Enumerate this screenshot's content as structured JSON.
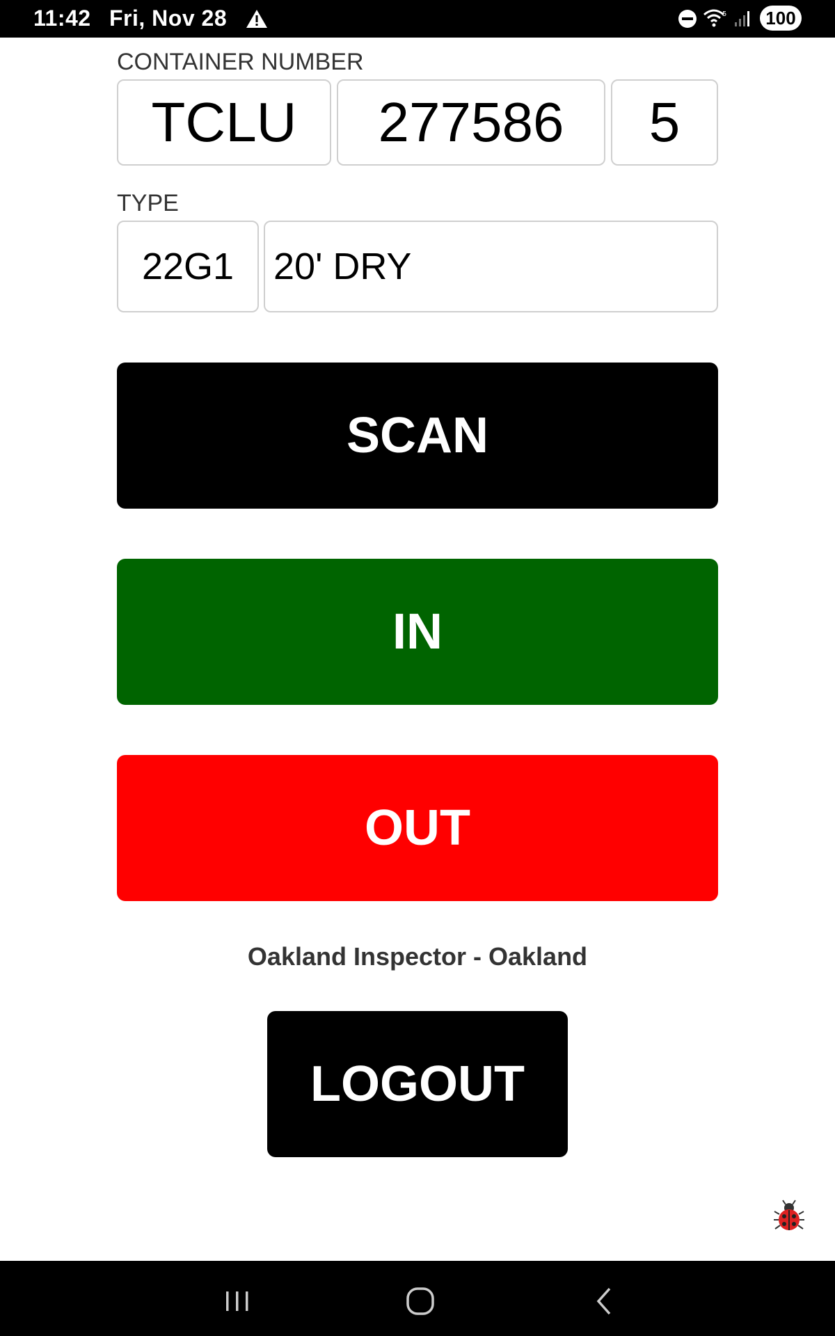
{
  "status_bar": {
    "time": "11:42",
    "date": "Fri, Nov 28",
    "battery": "100",
    "icons": [
      "warning-icon",
      "do-not-disturb-icon",
      "wifi-icon",
      "signal-icon",
      "battery-icon"
    ]
  },
  "container": {
    "label": "CONTAINER NUMBER",
    "prefix": "TCLU",
    "number": "277586",
    "check_digit": "5"
  },
  "type": {
    "label": "TYPE",
    "code": "22G1",
    "description": "20' DRY"
  },
  "buttons": {
    "scan": "SCAN",
    "in": "IN",
    "out": "OUT",
    "logout": "LOGOUT"
  },
  "user_info": "Oakland Inspector - Oakland",
  "colors": {
    "scan": "#000000",
    "in": "#006400",
    "out": "#ff0000",
    "logout": "#000000"
  },
  "nav": {
    "icons": [
      "recents-icon",
      "home-icon",
      "back-icon"
    ]
  }
}
